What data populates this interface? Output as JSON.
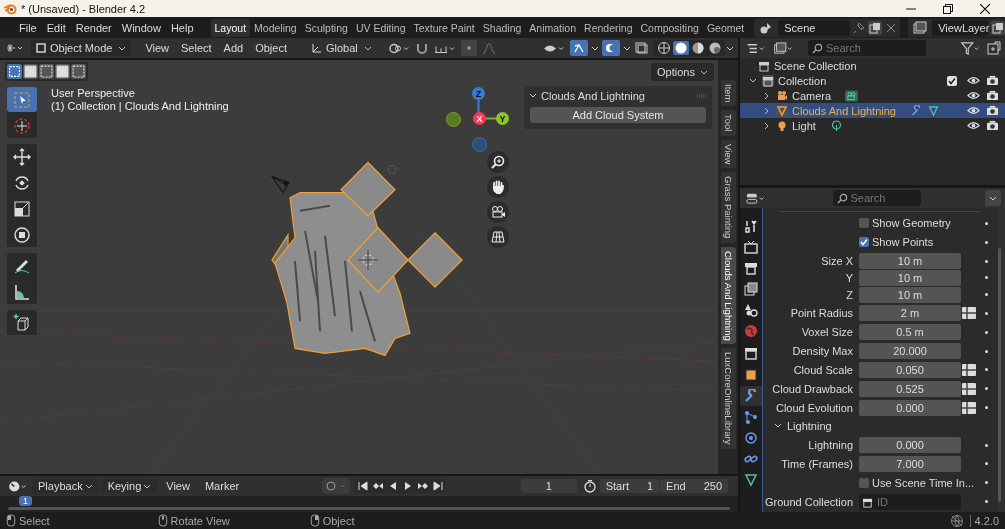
{
  "window": {
    "title": "* (Unsaved) - Blender 4.2"
  },
  "menu": [
    "File",
    "Edit",
    "Render",
    "Window",
    "Help"
  ],
  "workspaces": [
    {
      "label": "Layout",
      "selected": true
    },
    {
      "label": "Modeling",
      "selected": false
    },
    {
      "label": "Sculpting",
      "selected": false
    },
    {
      "label": "UV Editing",
      "selected": false
    },
    {
      "label": "Texture Paint",
      "selected": false
    },
    {
      "label": "Shading",
      "selected": false
    },
    {
      "label": "Animation",
      "selected": false
    },
    {
      "label": "Rendering",
      "selected": false
    },
    {
      "label": "Compositing",
      "selected": false
    },
    {
      "label": "Geomet",
      "selected": false
    }
  ],
  "scene": "Scene",
  "view_layer": "ViewLayer",
  "viewport_header": {
    "mode": "Object Mode",
    "menus": [
      "View",
      "Select",
      "Add",
      "Object"
    ],
    "orientation": "Global"
  },
  "selection_modes": [
    {
      "selected": true
    },
    {
      "selected": false
    },
    {
      "selected": false
    },
    {
      "selected": false
    },
    {
      "selected": false
    }
  ],
  "tool_groups": [
    {
      "tools": [
        {
          "kind": "select-box",
          "selected": true
        },
        {
          "kind": "cursor",
          "selected": false
        }
      ]
    },
    {
      "tools": [
        {
          "kind": "move",
          "selected": false
        },
        {
          "kind": "rotate",
          "selected": false
        },
        {
          "kind": "scale",
          "selected": false
        },
        {
          "kind": "transform",
          "selected": false
        }
      ]
    },
    {
      "tools": [
        {
          "kind": "annotate",
          "selected": false
        },
        {
          "kind": "measure",
          "selected": false
        }
      ]
    },
    {
      "tools": [
        {
          "kind": "add-cube",
          "selected": false
        }
      ]
    }
  ],
  "viewport": {
    "view_name": "User Perspective",
    "object_info": "(1) Collection | Clouds And Lightning",
    "options": "Options",
    "gizmo_axes": [
      "Z",
      "X",
      "Y"
    ]
  },
  "sidebar_panel": {
    "title": "Clouds And Lightning",
    "expanded": true,
    "button": "Add Cloud System"
  },
  "sidebar_tabs": [
    {
      "label": "Item",
      "selected": false
    },
    {
      "label": "Tool",
      "selected": false
    },
    {
      "label": "View",
      "selected": false
    },
    {
      "label": "Grass Painting",
      "selected": false
    },
    {
      "label": "Clouds And Lightning",
      "selected": true
    },
    {
      "label": "LuxCoreOnlineLibrary",
      "selected": false
    }
  ],
  "outliner": {
    "search_placeholder": "Search",
    "root": "Scene Collection",
    "collection": {
      "name": "Collection",
      "expanded": true,
      "checked": true,
      "children": [
        {
          "name": "Camera",
          "kind": "camera",
          "selected": false,
          "expanded": false
        },
        {
          "name": "Clouds And Lightning",
          "kind": "mesh",
          "selected": true,
          "expanded": false
        },
        {
          "name": "Light",
          "kind": "light",
          "selected": false,
          "expanded": false
        }
      ]
    }
  },
  "properties": {
    "search_placeholder": "Search",
    "tabs": [
      {
        "kind": "tool",
        "selected": false
      },
      {
        "kind": "render",
        "selected": false
      },
      {
        "kind": "output",
        "selected": false
      },
      {
        "kind": "view-layer",
        "selected": false
      },
      {
        "kind": "scene",
        "selected": false
      },
      {
        "kind": "world",
        "selected": false
      },
      {
        "kind": "collection",
        "selected": false
      },
      {
        "kind": "object",
        "selected": false
      },
      {
        "kind": "modifier",
        "selected": true
      },
      {
        "kind": "particles",
        "selected": false
      },
      {
        "kind": "physics",
        "selected": false
      },
      {
        "kind": "constraints",
        "selected": false
      },
      {
        "kind": "data",
        "selected": false
      }
    ],
    "rows": [
      {
        "kind": "checkbox",
        "label": "Show Geometry",
        "checked": false
      },
      {
        "kind": "checkbox",
        "label": "Show Points",
        "checked": true
      },
      {
        "kind": "number",
        "label": "Size X",
        "value": "10 m",
        "key_button": false
      },
      {
        "kind": "number",
        "label": "Y",
        "value": "10 m",
        "key_button": false
      },
      {
        "kind": "number",
        "label": "Z",
        "value": "10 m",
        "key_button": false
      },
      {
        "kind": "number",
        "label": "Point Radius",
        "value": "2 m",
        "key_button": true
      },
      {
        "kind": "number",
        "label": "Voxel Size",
        "value": "0.5 m",
        "key_button": false
      },
      {
        "kind": "number",
        "label": "Density Max",
        "value": "20.000",
        "key_button": false
      },
      {
        "kind": "number",
        "label": "Cloud Scale",
        "value": "0.050",
        "key_button": true
      },
      {
        "kind": "number",
        "label": "Cloud Drawback",
        "value": "0.525",
        "key_button": true
      },
      {
        "kind": "number",
        "label": "Cloud Evolution",
        "value": "0.000",
        "key_button": true
      },
      {
        "kind": "section",
        "label": "Lightning",
        "expanded": true
      },
      {
        "kind": "number",
        "label": "Lightning",
        "value": "0.000",
        "key_button": false
      },
      {
        "kind": "number",
        "label": "Time (Frames)",
        "value": "7.000",
        "key_button": false
      },
      {
        "kind": "checkbox",
        "label": "Use Scene Time In...",
        "checked": false
      },
      {
        "kind": "id",
        "label": "Ground Collection",
        "placeholder": "ID"
      }
    ]
  },
  "timeline": {
    "menus": [
      "Playback",
      "Keying",
      "View",
      "Marker"
    ],
    "current_frame": "1",
    "start_label": "Start",
    "start": "1",
    "end_label": "End",
    "end": "250",
    "playhead": "1"
  },
  "status_bar": {
    "hints": [
      "Select",
      "Rotate View",
      "Object"
    ],
    "version": "4.2.0"
  }
}
